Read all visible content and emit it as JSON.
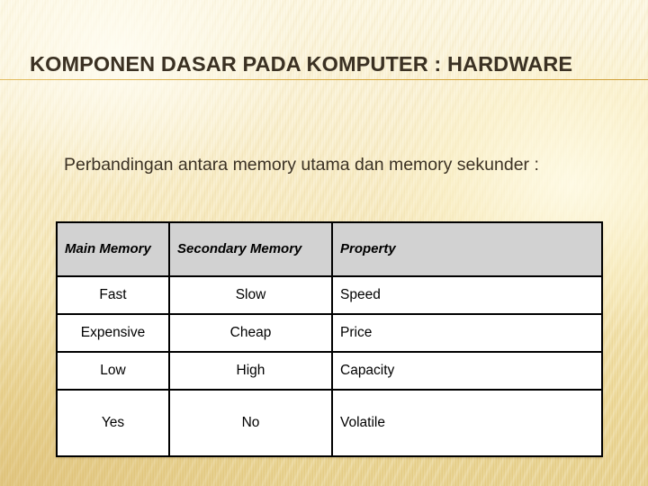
{
  "slide": {
    "title": "KOMPONEN DASAR PADA KOMPUTER : HARDWARE",
    "intro": "Perbandingan antara memory utama dan memory sekunder :",
    "colors": {
      "title_text": "#3b3123",
      "title_rule": "#d6a83f",
      "body_text": "#3b3123",
      "table_header_bg": "#d2d2d2",
      "table_cell_bg": "#ffffff",
      "table_border": "#000000",
      "background_top": "#fdf8e2",
      "background_bottom": "#e6cf89"
    }
  },
  "table": {
    "headers": [
      "Main Memory",
      "Secondary Memory",
      "Property"
    ],
    "rows": [
      {
        "main": "Fast",
        "secondary": "Slow",
        "property": "Speed"
      },
      {
        "main": "Expensive",
        "secondary": "Cheap",
        "property": "Price"
      },
      {
        "main": "Low",
        "secondary": "High",
        "property": "Capacity"
      },
      {
        "main": "Yes",
        "secondary": "No",
        "property": "Volatile"
      }
    ]
  }
}
